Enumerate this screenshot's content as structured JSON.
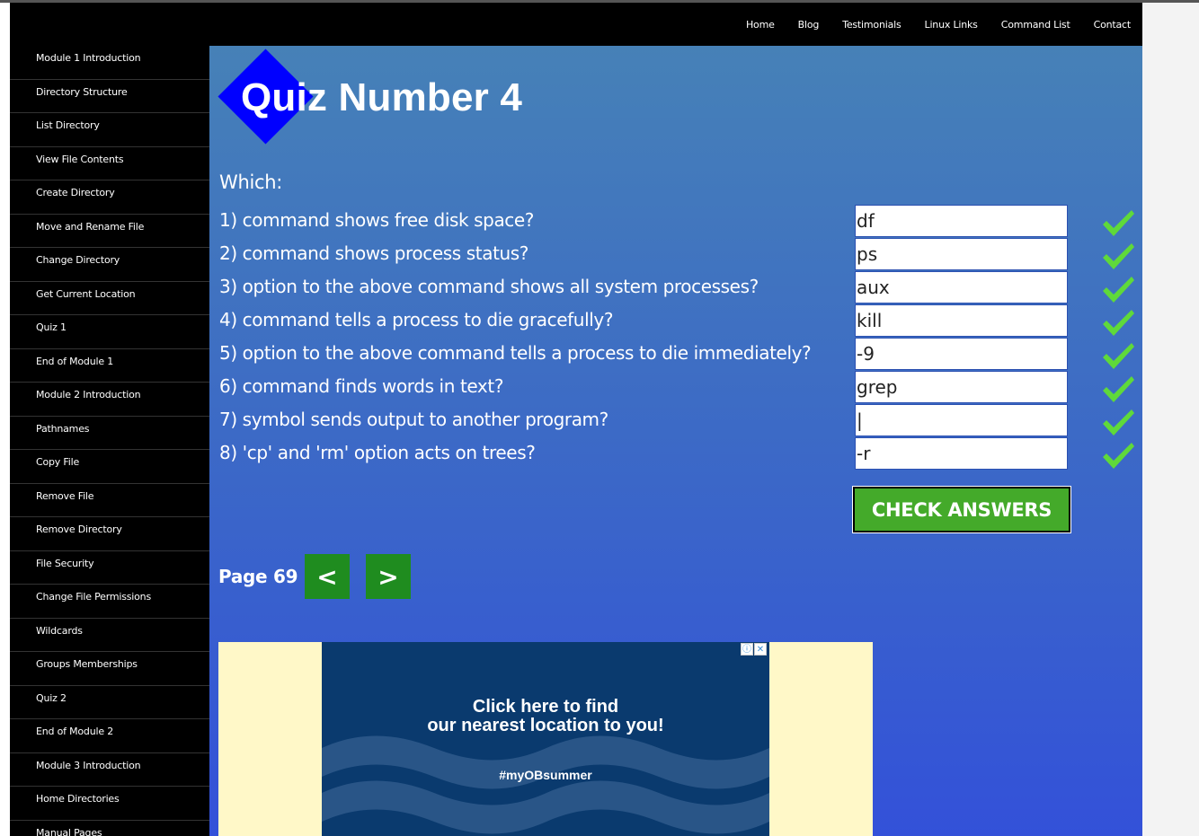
{
  "nav": {
    "items": [
      "Home",
      "Blog",
      "Testimonials",
      "Linux Links",
      "Command List",
      "Contact"
    ]
  },
  "sidebar": {
    "items": [
      "Module 1 Introduction",
      "Directory Structure",
      "List Directory",
      "View File Contents",
      "Create Directory",
      "Move and Rename File",
      "Change Directory",
      "Get Current Location",
      "Quiz 1",
      "End of Module 1",
      "Module 2 Introduction",
      "Pathnames",
      "Copy File",
      "Remove File",
      "Remove Directory",
      "File Security",
      "Change File Permissions",
      "Wildcards",
      "Groups Memberships",
      "Quiz 2",
      "End of Module 2",
      "Module 3 Introduction",
      "Home Directories",
      "Manual Pages"
    ]
  },
  "quiz": {
    "title": "Quiz Number 4",
    "prompt": "Which:",
    "questions": [
      {
        "text": "1) command shows free disk space?",
        "answer": "df",
        "correct": true
      },
      {
        "text": "2) command shows process status?",
        "answer": "ps",
        "correct": true
      },
      {
        "text": "3) option to the above command shows all system processes?",
        "answer": "aux",
        "correct": true
      },
      {
        "text": "4) command tells a process to die gracefully?",
        "answer": "kill",
        "correct": true
      },
      {
        "text": "5) option to the above command tells a process to die immediately?",
        "answer": "-9",
        "correct": true
      },
      {
        "text": "6) command finds words in text?",
        "answer": "grep",
        "correct": true
      },
      {
        "text": "7) symbol sends output to another program?",
        "answer": "|",
        "correct": true
      },
      {
        "text": "8) 'cp' and 'rm' option acts on trees?",
        "answer": "-r",
        "correct": true
      }
    ],
    "check_label": "CHECK ANSWERS"
  },
  "pager": {
    "label": "Page 69",
    "prev": "<",
    "next": ">"
  },
  "ad": {
    "line1": "Click here to find",
    "line2": "our nearest location to you!",
    "tag": "#myOBsummer",
    "info_icon": "ⓘ",
    "close_icon": "✕"
  },
  "colors": {
    "check_green": "#5fd93a",
    "button_green": "#44aa2a",
    "pager_green": "#1f8c1f",
    "diamond_blue": "#0000ff"
  }
}
